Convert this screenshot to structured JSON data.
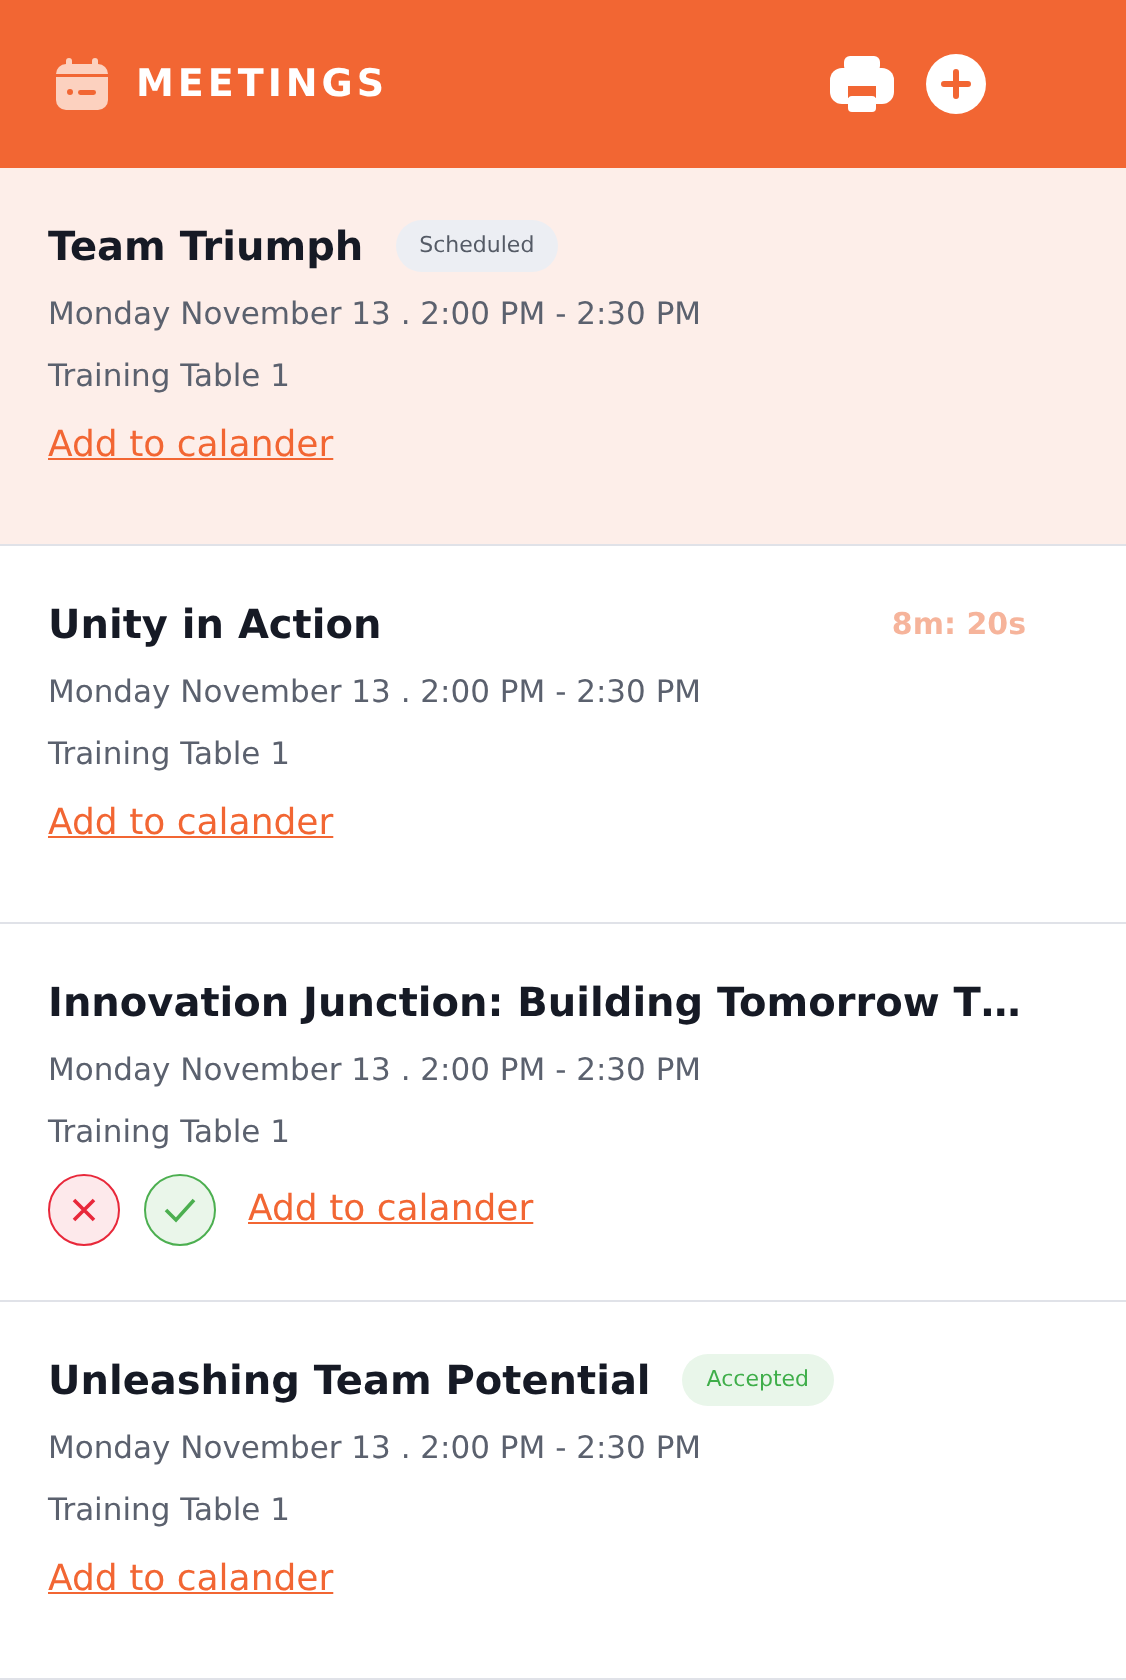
{
  "header": {
    "title": "MEETINGS"
  },
  "meetings": [
    {
      "title": "Team Triumph",
      "selected": true,
      "status": {
        "label": "Scheduled",
        "kind": "scheduled"
      },
      "when": "Monday November 13 . 2:00 PM - 2:30 PM",
      "place": "Training Table 1",
      "link": "Add to calander"
    },
    {
      "title": "Unity in Action",
      "selected": false,
      "timer": "8m: 20s",
      "when": "Monday November 13 . 2:00 PM - 2:30 PM",
      "place": "Training Table 1",
      "link": "Add to calander"
    },
    {
      "title": "Innovation Junction: Building Tomorrow T…",
      "selected": false,
      "actions": [
        {
          "kind": "decline"
        },
        {
          "kind": "accept"
        }
      ],
      "when": "Monday November 13 . 2:00 PM - 2:30 PM",
      "place": "Training Table 1",
      "link": "Add to calander"
    },
    {
      "title": "Unleashing Team Potential",
      "selected": false,
      "status": {
        "label": "Accepted",
        "kind": "accepted"
      },
      "when": "Monday November 13 . 2:00 PM - 2:30 PM",
      "place": "Training Table 1",
      "link": "Add to calander"
    }
  ]
}
